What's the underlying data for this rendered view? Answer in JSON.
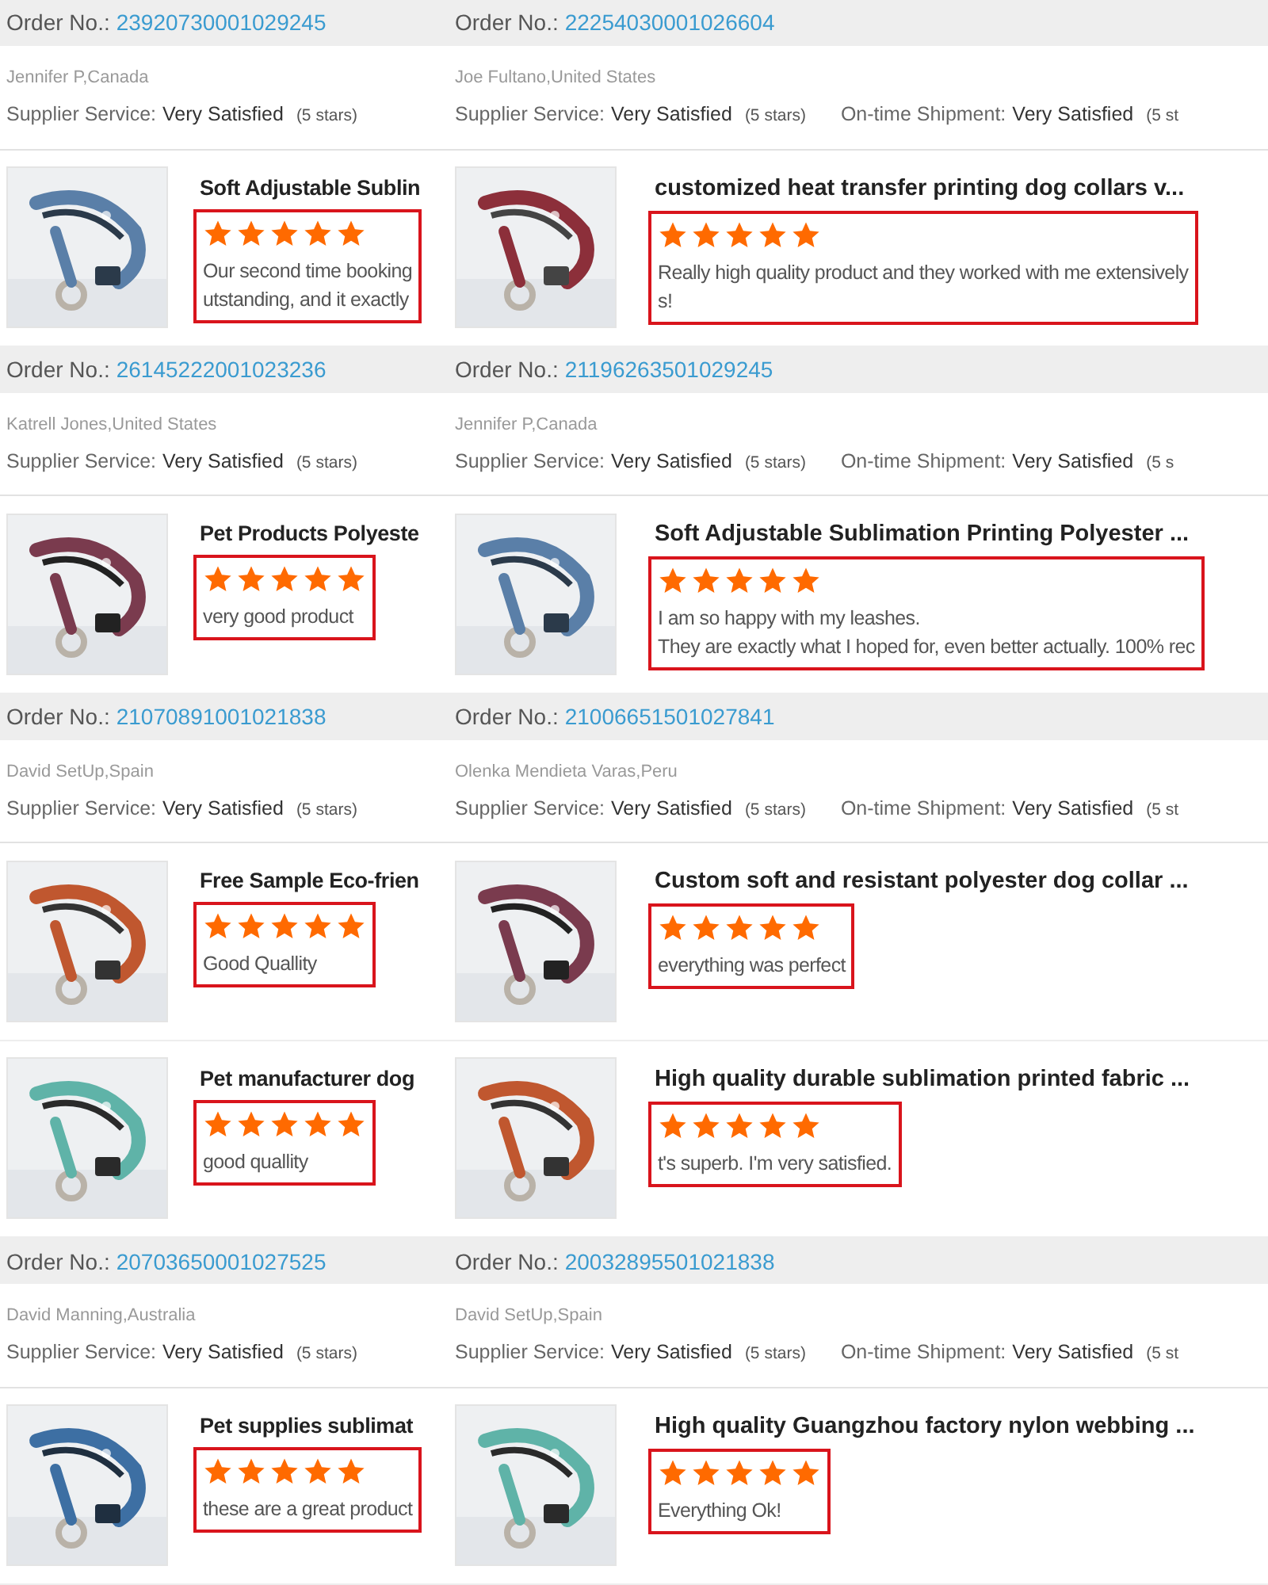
{
  "columns": [
    {
      "segments": [
        {
          "kind": "order",
          "label": "Order No.:",
          "number": "23920730001029245"
        },
        {
          "kind": "buyer",
          "name": "Jennifer P,Canada",
          "ratings": [
            {
              "label": "Supplier Service:",
              "value": "Very Satisfied",
              "note": "(5 stars)"
            }
          ]
        },
        {
          "kind": "product",
          "title": "Soft Adjustable Sublin",
          "stars": 5,
          "review_lines": [
            "Our second time booking",
            "utstanding, and it exactly"
          ]
        },
        {
          "kind": "order",
          "label": "Order No.:",
          "number": "26145222001023236"
        },
        {
          "kind": "buyer",
          "name": "Katrell Jones,United States",
          "ratings": [
            {
              "label": "Supplier Service:",
              "value": "Very Satisfied",
              "note": "(5 stars)"
            }
          ]
        },
        {
          "kind": "product",
          "title": "Pet Products Polyeste",
          "stars": 5,
          "review_lines": [
            "very good product"
          ]
        },
        {
          "kind": "order",
          "label": "Order No.:",
          "number": "21070891001021838"
        },
        {
          "kind": "buyer",
          "name": "David SetUp,Spain",
          "ratings": [
            {
              "label": "Supplier Service:",
              "value": "Very Satisfied",
              "note": "(5 stars)"
            }
          ]
        },
        {
          "kind": "product",
          "title": "Free Sample Eco-frien",
          "stars": 5,
          "review_lines": [
            "Good Quallity"
          ]
        },
        {
          "kind": "product",
          "title": "Pet manufacturer dog",
          "stars": 5,
          "review_lines": [
            "good quallity"
          ]
        },
        {
          "kind": "order",
          "label": "Order No.:",
          "number": "20703650001027525"
        },
        {
          "kind": "buyer",
          "name": "David Manning,Australia",
          "ratings": [
            {
              "label": "Supplier Service:",
              "value": "Very Satisfied",
              "note": "(5 stars)"
            }
          ]
        },
        {
          "kind": "product",
          "title": "Pet supplies sublimat",
          "stars": 5,
          "review_lines": [
            "these are a great product"
          ]
        }
      ]
    },
    {
      "segments": [
        {
          "kind": "order",
          "label": "Order No.:",
          "number": "22254030001026604"
        },
        {
          "kind": "buyer",
          "name": "Joe Fultano,United States",
          "ratings": [
            {
              "label": "Supplier Service:",
              "value": "Very Satisfied",
              "note": "(5 stars)"
            },
            {
              "label": "On-time Shipment:",
              "value": "Very Satisfied",
              "note": "(5 st"
            }
          ]
        },
        {
          "kind": "product",
          "title": "customized heat transfer printing dog collars v...",
          "stars": 5,
          "review_lines": [
            "Really high quality product and they worked with me extensively",
            "s!"
          ]
        },
        {
          "kind": "order",
          "label": "Order No.:",
          "number": "21196263501029245"
        },
        {
          "kind": "buyer",
          "name": "Jennifer P,Canada",
          "ratings": [
            {
              "label": "Supplier Service:",
              "value": "Very Satisfied",
              "note": "(5 stars)"
            },
            {
              "label": "On-time Shipment:",
              "value": "Very Satisfied",
              "note": "(5 s"
            }
          ]
        },
        {
          "kind": "product",
          "title": "Soft Adjustable Sublimation Printing Polyester ...",
          "stars": 5,
          "review_lines": [
            "I am so happy with my leashes.",
            "They are exactly what I hoped for, even better actually. 100% rec"
          ]
        },
        {
          "kind": "order",
          "label": "Order No.:",
          "number": "21006651501027841"
        },
        {
          "kind": "buyer",
          "name": "Olenka Mendieta Varas,Peru",
          "ratings": [
            {
              "label": "Supplier Service:",
              "value": "Very Satisfied",
              "note": "(5 stars)"
            },
            {
              "label": "On-time Shipment:",
              "value": "Very Satisfied",
              "note": "(5 st"
            }
          ]
        },
        {
          "kind": "product",
          "title": "Custom soft and resistant polyester dog collar ...",
          "stars": 5,
          "review_lines": [
            "everything was perfect"
          ]
        },
        {
          "kind": "product",
          "title": "High quality durable sublimation printed fabric ...",
          "stars": 5,
          "review_lines": [
            "t's superb. I'm very satisfied."
          ]
        },
        {
          "kind": "order",
          "label": "Order No.:",
          "number": "20032895501021838"
        },
        {
          "kind": "buyer",
          "name": "David SetUp,Spain",
          "ratings": [
            {
              "label": "Supplier Service:",
              "value": "Very Satisfied",
              "note": "(5 stars)"
            },
            {
              "label": "On-time Shipment:",
              "value": "Very Satisfied",
              "note": "(5 st"
            }
          ]
        },
        {
          "kind": "product",
          "title": "High quality Guangzhou factory nylon webbing ...",
          "stars": 5,
          "review_lines": [
            "Everything Ok!"
          ]
        }
      ]
    }
  ]
}
